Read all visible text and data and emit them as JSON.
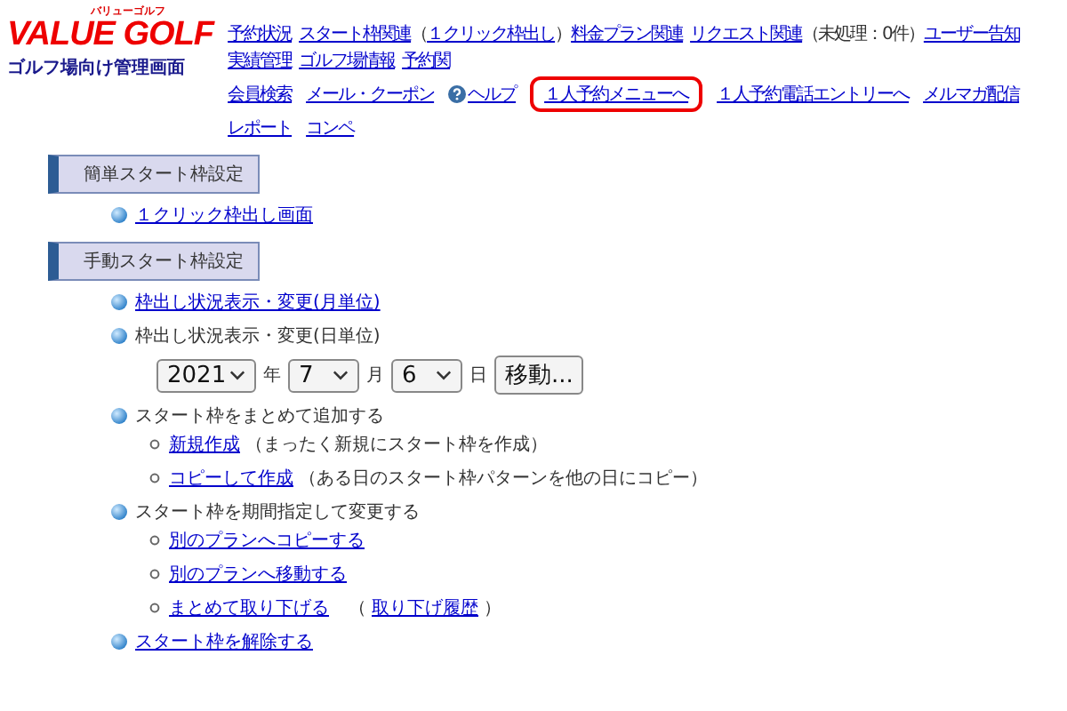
{
  "header": {
    "logo_text": "VALUE GOLF",
    "logo_kana": "バリューゴルフ",
    "subtitle": "ゴルフ場向け管理画面",
    "nav_row1": [
      {
        "kind": "link",
        "label": "予約状況"
      },
      {
        "kind": "link",
        "label": "スタート枠関連"
      },
      {
        "kind": "text",
        "label": "（"
      },
      {
        "kind": "link",
        "label": "１クリック枠出し"
      },
      {
        "kind": "text",
        "label": "）"
      },
      {
        "kind": "link",
        "label": "料金プラン関連"
      },
      {
        "kind": "link",
        "label": "リクエスト関連"
      },
      {
        "kind": "text",
        "label": "（未処理：0件）"
      },
      {
        "kind": "link",
        "label": "ユーザー告知"
      },
      {
        "kind": "link",
        "label": "実績管理"
      },
      {
        "kind": "link",
        "label": "ゴルフ場情報"
      },
      {
        "kind": "link",
        "label": "予約関"
      }
    ],
    "nav_row2": [
      {
        "kind": "link",
        "label": "会員検索",
        "highlighted": false
      },
      {
        "kind": "link",
        "label": "メール・クーポン",
        "highlighted": false
      },
      {
        "kind": "help",
        "label": "ヘルプ",
        "highlighted": false
      },
      {
        "kind": "link",
        "label": "１人予約メニューへ",
        "highlighted": true
      },
      {
        "kind": "link",
        "label": "１人予約電話エントリーへ",
        "highlighted": false
      },
      {
        "kind": "link",
        "label": "メルマガ配信",
        "highlighted": false
      },
      {
        "kind": "link",
        "label": "レポート",
        "highlighted": false
      },
      {
        "kind": "link",
        "label": "コンペ"
      }
    ]
  },
  "sections": [
    {
      "title": "簡単スタート枠設定",
      "items": [
        {
          "kind": "link",
          "label": "１クリック枠出し画面"
        }
      ]
    },
    {
      "title": "手動スタート枠設定",
      "items": [
        {
          "kind": "link",
          "label": "枠出し状況表示・変更(月単位)"
        },
        {
          "kind": "date",
          "label": "枠出し状況表示・変更(日単位)",
          "year": "2021",
          "year_unit": "年",
          "month": "7",
          "month_unit": "月",
          "day": "6",
          "day_unit": "日",
          "button": "移動..."
        },
        {
          "kind": "group",
          "label": "スタート枠をまとめて追加する",
          "children": [
            {
              "link": "新規作成",
              "note": "（まったく新規にスタート枠を作成）"
            },
            {
              "link": "コピーして作成",
              "note": "（ある日のスタート枠パターンを他の日にコピー）"
            }
          ]
        },
        {
          "kind": "group",
          "label": "スタート枠を期間指定して変更する",
          "children": [
            {
              "link": "別のプランへコピーする"
            },
            {
              "link": "別のプランへ移動する"
            },
            {
              "link": "まとめて取り下げる",
              "note_before": "（",
              "note_link": "取り下げ履歴",
              "note_after": "）"
            }
          ]
        },
        {
          "kind": "link",
          "label": "スタート枠を解除する"
        }
      ]
    }
  ]
}
